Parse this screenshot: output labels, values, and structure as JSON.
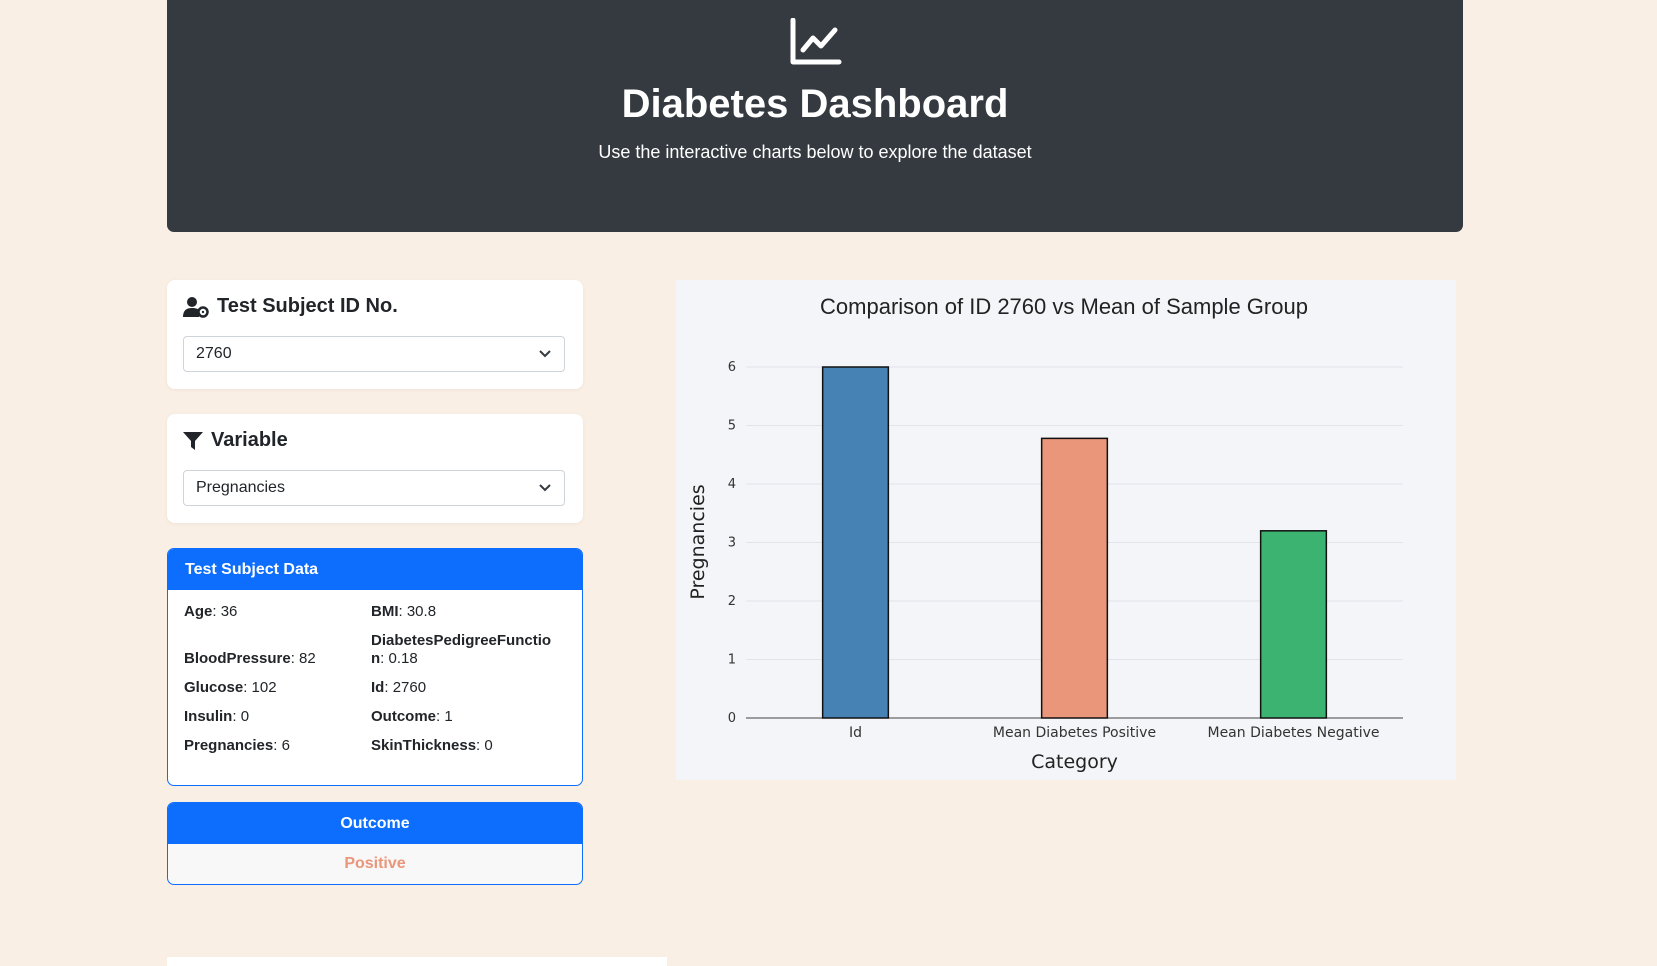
{
  "header": {
    "title": "Diabetes Dashboard",
    "subtitle": "Use the interactive charts below to explore the dataset",
    "icon": "line-chart-icon"
  },
  "subject_select": {
    "title": "Test Subject ID No.",
    "icon": "user-gear-icon",
    "value": "2760"
  },
  "variable_select": {
    "title": "Variable",
    "icon": "filter-icon",
    "value": "Pregnancies"
  },
  "subject_data": {
    "title": "Test Subject Data",
    "rows": [
      [
        {
          "key": "Age",
          "value": "36"
        },
        {
          "key": "BMI",
          "value": "30.8"
        }
      ],
      [
        {
          "key": "BloodPressure",
          "value": "82"
        },
        {
          "key": "DiabetesPedigreeFunction",
          "value": "0.18"
        }
      ],
      [
        {
          "key": "Glucose",
          "value": "102"
        },
        {
          "key": "Id",
          "value": "2760"
        }
      ],
      [
        {
          "key": "Insulin",
          "value": "0"
        },
        {
          "key": "Outcome",
          "value": "1"
        }
      ],
      [
        {
          "key": "Pregnancies",
          "value": "6"
        },
        {
          "key": "SkinThickness",
          "value": "0"
        }
      ]
    ]
  },
  "outcome": {
    "title": "Outcome",
    "value": "Positive",
    "color": "#e9967a"
  },
  "chart_data": {
    "type": "bar",
    "title": "Comparison of ID 2760 vs Mean of Sample Group",
    "xlabel": "Category",
    "ylabel": "Pregnancies",
    "categories": [
      "Id",
      "Mean Diabetes Positive",
      "Mean Diabetes Negative"
    ],
    "values": [
      6,
      4.78,
      3.2
    ],
    "colors": [
      "#4682b4",
      "#e9967a",
      "#3cb371"
    ],
    "ylim": [
      0,
      6
    ],
    "yticks": [
      0,
      1,
      2,
      3,
      4,
      5,
      6
    ],
    "grid": true
  }
}
